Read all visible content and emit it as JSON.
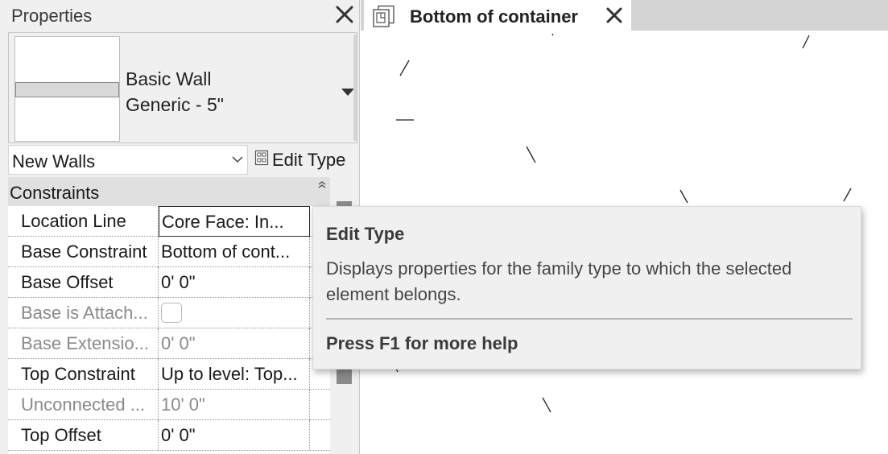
{
  "properties": {
    "title": "Properties",
    "type_selector": {
      "family": "Basic Wall",
      "type": "Generic - 5\""
    },
    "filter": {
      "selected": "New Walls"
    },
    "edit_type_label": "Edit Type",
    "group": "Constraints",
    "rows": [
      {
        "name": "Location Line",
        "value": "Core Face: In...",
        "enabled": true
      },
      {
        "name": "Base Constraint",
        "value": "Bottom of cont...",
        "enabled": true
      },
      {
        "name": "Base Offset",
        "value": "0'  0\"",
        "enabled": true
      },
      {
        "name": "Base is Attach...",
        "value": "",
        "enabled": false,
        "checkbox": true,
        "checked": false
      },
      {
        "name": "Base Extensio...",
        "value": "0'  0\"",
        "enabled": false
      },
      {
        "name": "Top Constraint",
        "value": "Up to level: Top...",
        "enabled": true
      },
      {
        "name": "Unconnected ...",
        "value": "10'  0\"",
        "enabled": false
      },
      {
        "name": "Top Offset",
        "value": "0'  0\"",
        "enabled": true
      }
    ]
  },
  "view_tab": {
    "label": "Bottom of container"
  },
  "tooltip": {
    "title": "Edit Type",
    "body": "Displays properties for the family type to which the selected element belongs.",
    "help": "Press F1 for more help"
  },
  "icons": {
    "close": "close-icon",
    "dropdown": "dropdown-arrow-icon",
    "chevron": "chevron-down-icon",
    "edit_type": "edit-type-icon",
    "view": "floor-plan-view-icon",
    "collapse": "collapse-caret-icon"
  },
  "colors": {
    "panel_bg": "#f0f0f0",
    "group_bg": "#e0e0e0",
    "tab_strip": "#d4d4d4",
    "muted_text": "#8a8a8a"
  }
}
